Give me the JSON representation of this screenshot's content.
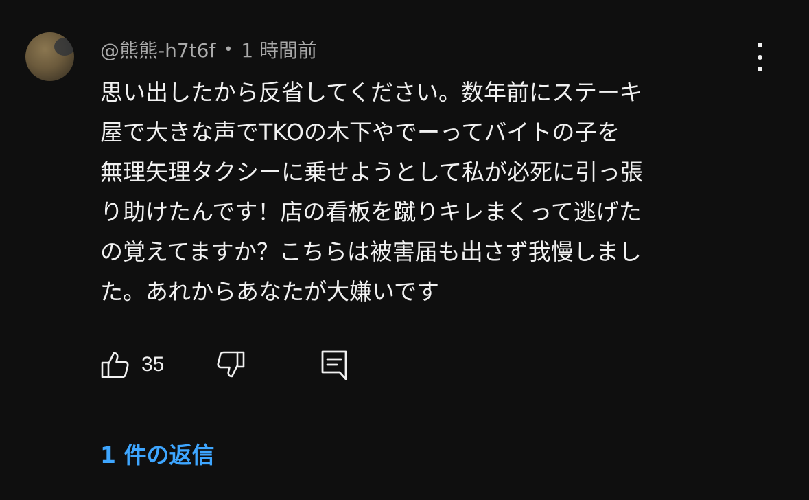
{
  "comment": {
    "author": "@熊熊-h7t6f",
    "separator": "•",
    "time": "1 時間前",
    "lines": [
      "思い出したから反省してください。数年前にステーキ",
      "屋で大きな声でTKOの木下やでーってバイトの子を",
      "無理矢理タクシーに乗せようとして私が必死に引っ張",
      "り助けたんです！店の看板を蹴りキレまくって逃げた",
      "の覚えてますか？こちらは被害届も出さず我慢しまし",
      "た。あれからあなたが大嫌いです"
    ],
    "like_count": "35",
    "replies_label": "1 件の返信"
  },
  "icons": {
    "like": "thumbs-up-icon",
    "dislike": "thumbs-down-icon",
    "reply": "comment-reply-icon",
    "menu": "more-vert-icon"
  },
  "colors": {
    "background": "#0f0f0f",
    "text": "#f1f1f1",
    "secondary_text": "#aaaaaa",
    "link": "#3ea6ff"
  }
}
